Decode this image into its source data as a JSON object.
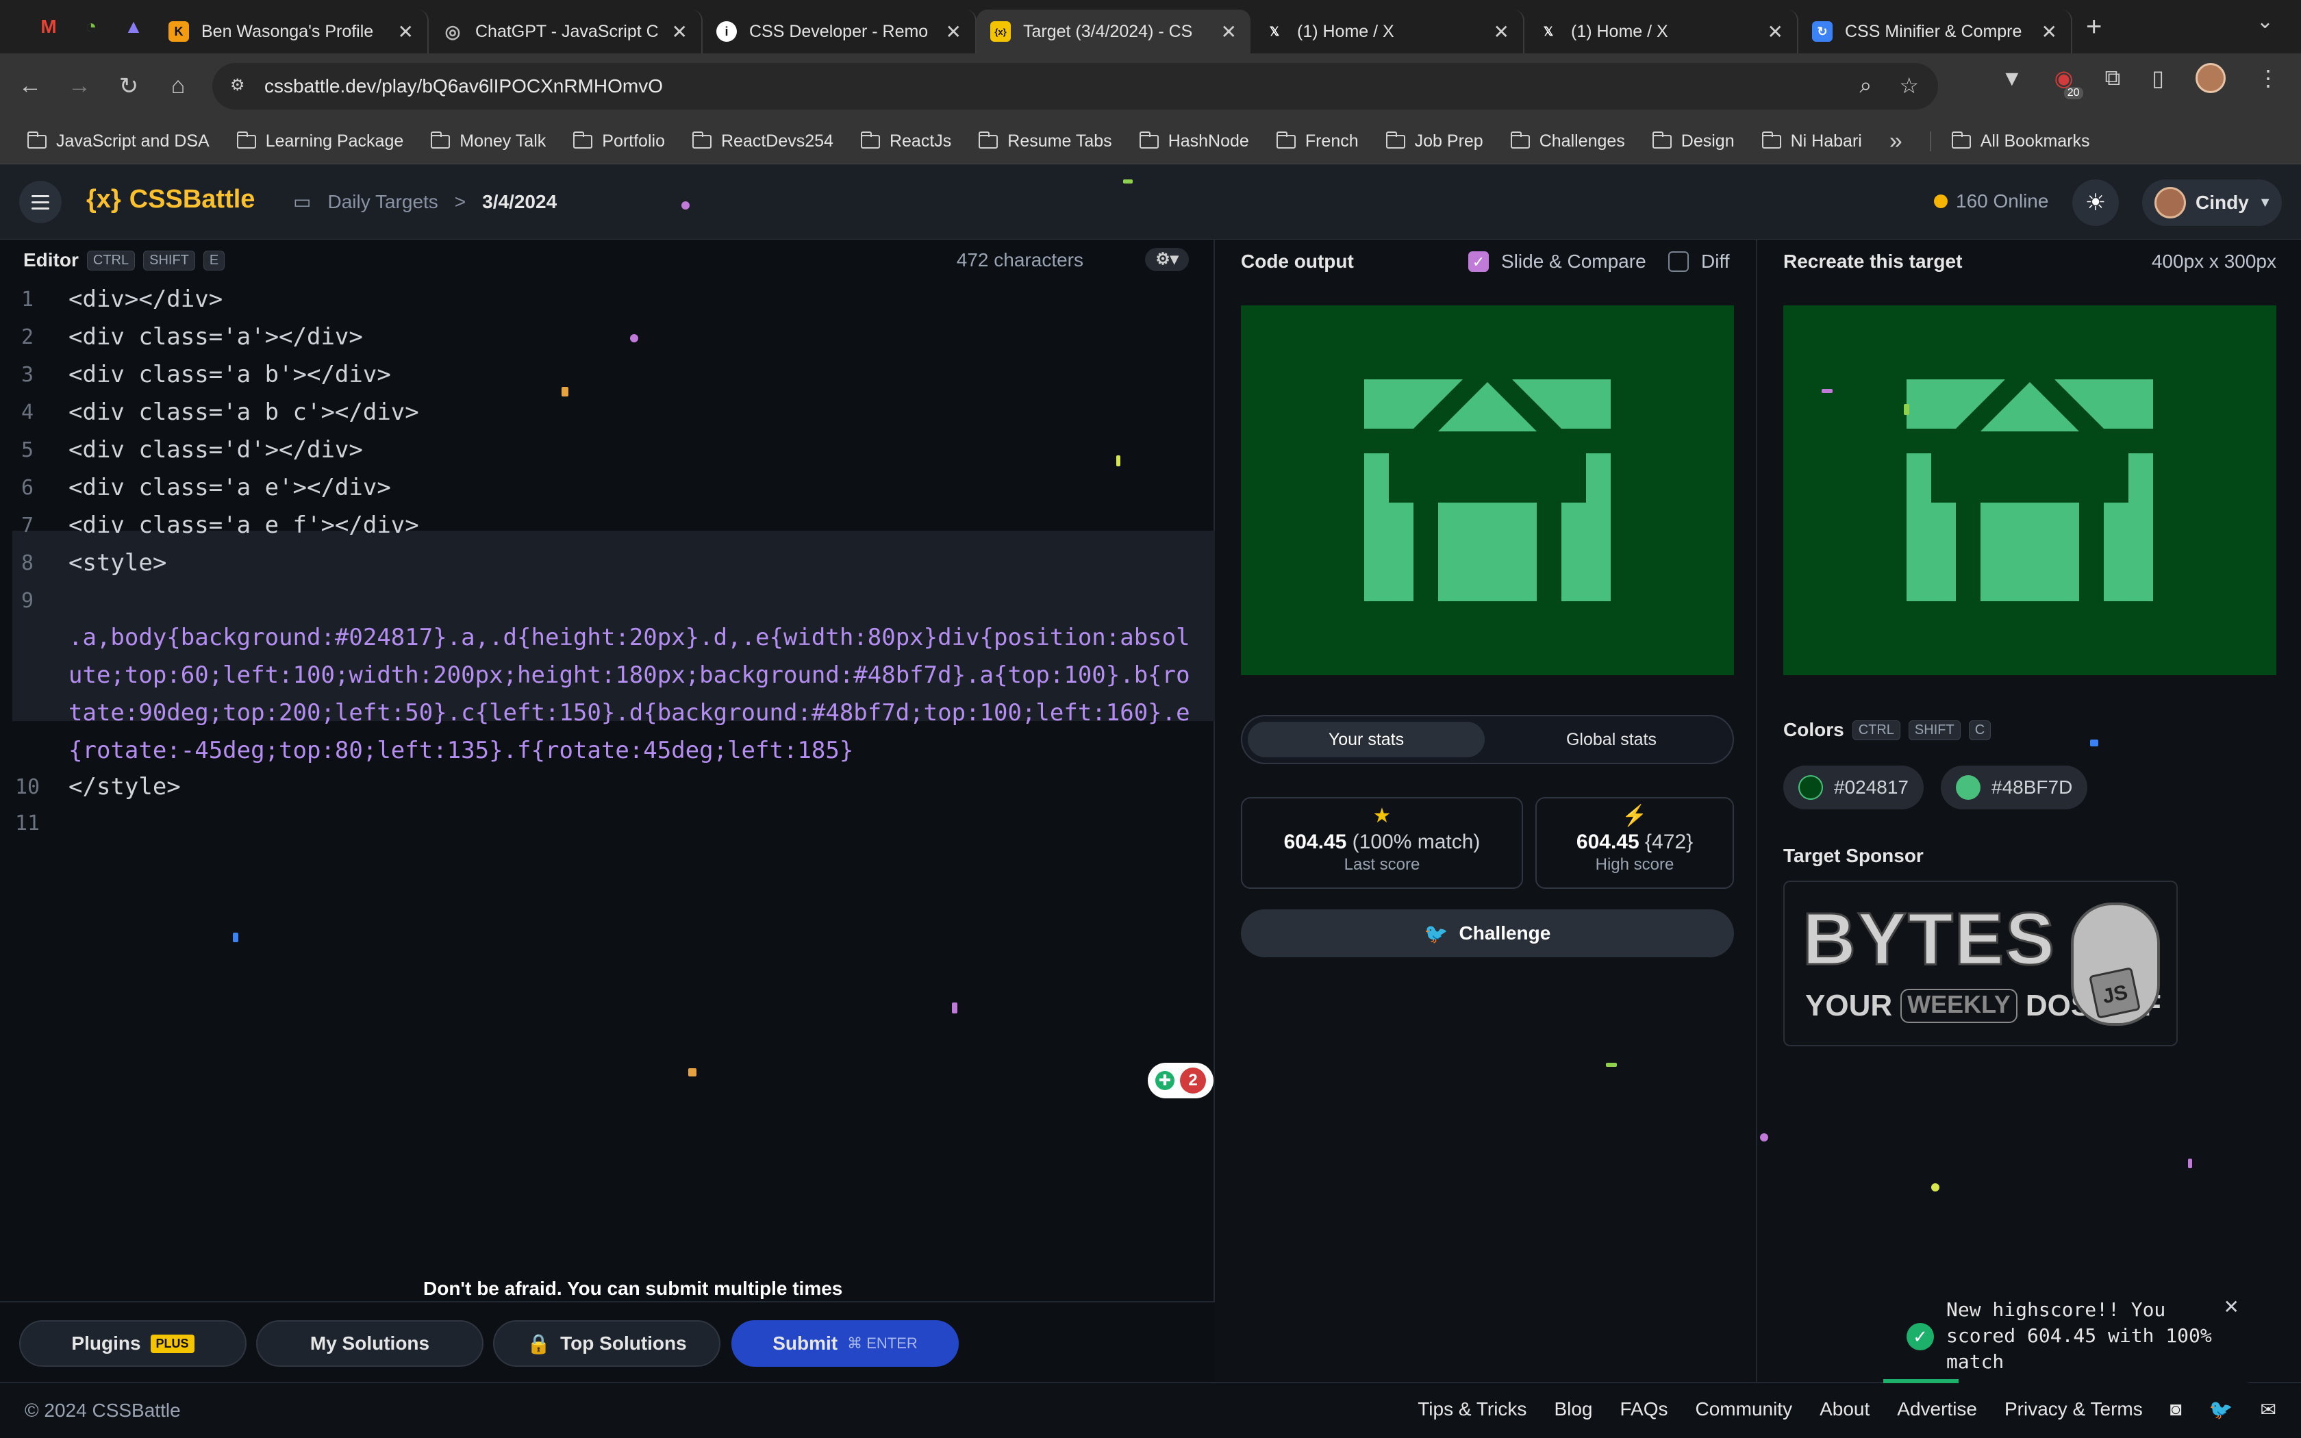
{
  "browser": {
    "pinned_tabs": [
      {
        "name": "gmail-icon",
        "glyph": "M",
        "color": "#ea4335"
      },
      {
        "name": "app-icon",
        "glyph": "◔",
        "color": "#7bc142"
      },
      {
        "name": "app-icon-2",
        "glyph": "▲",
        "color": "#8a7cf5"
      }
    ],
    "tabs": [
      {
        "title": "Ben Wasonga's Profile",
        "fav": "K",
        "favcolor": "#f39c12",
        "active": false
      },
      {
        "title": "ChatGPT - JavaScript C",
        "fav": "◎",
        "favcolor": "#999999",
        "active": false
      },
      {
        "title": "CSS Developer - Remo",
        "fav": "i",
        "favcolor": "#ffffff",
        "active": false
      },
      {
        "title": "Target (3/4/2024) - CS",
        "fav": "{x}",
        "favcolor": "#f5c400",
        "active": true
      },
      {
        "title": "(1) Home / X",
        "fav": "X",
        "favcolor": "#ffffff",
        "active": false
      },
      {
        "title": "(1) Home / X",
        "fav": "X",
        "favcolor": "#ffffff",
        "active": false
      },
      {
        "title": "CSS Minifier & Compre",
        "fav": "↻",
        "favcolor": "#3b82f6",
        "active": false
      }
    ],
    "url": "cssbattle.dev/play/bQ6av6lIPOCXnRMHOmvO",
    "extension_badge": "20",
    "bookmarks": [
      "JavaScript and DSA",
      "Learning Package",
      "Money Talk",
      "Portfolio",
      "ReactDevs254",
      "ReactJs",
      "Resume Tabs",
      "HashNode",
      "French",
      "Job Prep",
      "Challenges",
      "Design",
      "Ni Habari"
    ],
    "all_bookmarks": "All Bookmarks"
  },
  "header": {
    "logo": "CSSBattle",
    "breadcrumb_parent": "Daily Targets",
    "breadcrumb_sep": ">",
    "breadcrumb_current": "3/4/2024",
    "online_count": "160 Online",
    "user_name": "Cindy"
  },
  "editor": {
    "title": "Editor",
    "shortcut_keys": [
      "CTRL",
      "SHIFT",
      "E"
    ],
    "char_count": "472 characters",
    "line_numbers": [
      "1",
      "2",
      "3",
      "4",
      "5",
      "6",
      "7",
      "8",
      "9",
      "10",
      "11"
    ],
    "lines": [
      "<div></div>",
      "<div class='a'></div>",
      "<div class='a b'></div>",
      "<div class='a b c'></div>",
      "<div class='d'></div>",
      "<div class='a e'></div>",
      "<div class='a e f'></div>",
      "<style>",
      "",
      ".a,body{background:#024817}.a,.d{height:20px}.d,.e{width:80px}div{position:absol",
      "ute;top:60;left:100;width:200px;height:180px;background:#48bf7d}.a{top:100}.b{ro",
      "tate:90deg;top:200;left:50}.c{left:150}.d{background:#48bf7d;top:100;left:160}.e",
      "{rotate:-45deg;top:80;left:135}.f{rotate:45deg;left:185}",
      "</style>",
      ""
    ],
    "notification_count": "2"
  },
  "tooltip": "Don't be afraid. You can submit multiple times",
  "bottom_buttons": {
    "plugins": "Plugins",
    "plugins_badge": "PLUS",
    "my_solutions": "My Solutions",
    "top_solutions": "Top Solutions",
    "submit": "Submit",
    "submit_keys": "⌘  ENTER"
  },
  "output": {
    "title": "Code output",
    "slide_compare": "Slide & Compare",
    "slide_compare_checked": true,
    "diff": "Diff",
    "diff_checked": false,
    "tab_your_stats": "Your stats",
    "tab_global_stats": "Global stats",
    "last_score_value": "604.45",
    "last_score_detail": "(100% match)",
    "last_score_label": "Last score",
    "high_score_value": "604.45",
    "high_score_detail": "{472}",
    "high_score_label": "High score",
    "challenge": "Challenge"
  },
  "target": {
    "title": "Recreate this target",
    "size": "400px x 300px",
    "colors_label": "Colors",
    "colors_keys": [
      "CTRL",
      "SHIFT",
      "C"
    ],
    "colors": [
      {
        "hex": "#024817",
        "swatch": "#024817"
      },
      {
        "hex": "#48BF7D",
        "swatch": "#48bf7d"
      }
    ],
    "sponsor_label": "Target Sponsor",
    "sponsor_text_1": "BYTES",
    "sponsor_text_2": "YOUR",
    "sponsor_text_3": "WEEKLY",
    "sponsor_text_4": "DOSE OF",
    "sponsor_text_5": "JS"
  },
  "footer": {
    "copyright": "© 2024 CSSBattle",
    "links": [
      "Tips & Tricks",
      "Blog",
      "FAQs",
      "Community",
      "About",
      "Advertise",
      "Privacy & Terms"
    ]
  },
  "toast": {
    "message": "New highscore!! You scored 604.45 with 100% match"
  },
  "colors": {
    "bg_dark": "#024817",
    "shape_green": "#48bf7d",
    "brand_yellow": "#fbc02d",
    "submit_blue": "#2447c7"
  }
}
